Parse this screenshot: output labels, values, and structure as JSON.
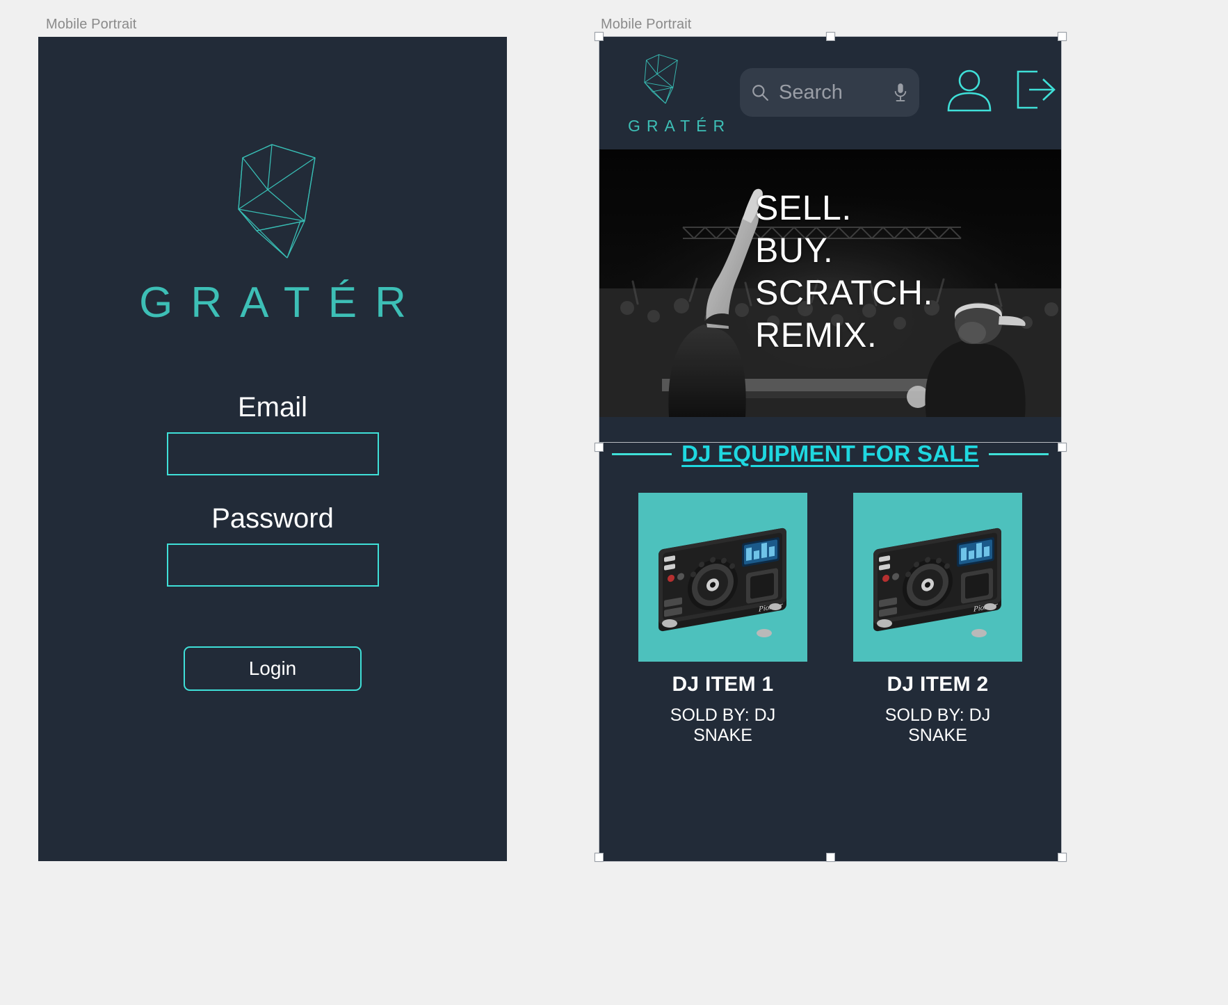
{
  "boards": {
    "left_label": "Mobile Portrait",
    "right_label": "Mobile Portrait"
  },
  "colors": {
    "canvas": "#f0f0f0",
    "screen_bg": "#222b38",
    "accent_cyan": "#3fe0d8",
    "brand_teal": "#3dbfb6",
    "product_tile": "#4dc1bd",
    "heading_cyan": "#1fd8e0",
    "search_pill": "#333c49",
    "muted_text": "#9a9ea6"
  },
  "login_screen": {
    "logo_icon": "crystal-wireframe-icon",
    "brand": "GRATÉR",
    "email": {
      "label": "Email",
      "value": "",
      "placeholder": ""
    },
    "password": {
      "label": "Password",
      "value": "",
      "placeholder": ""
    },
    "login_button": "Login"
  },
  "store_screen": {
    "header": {
      "logo_icon": "crystal-wireframe-icon",
      "brand": "GRATÉR",
      "search": {
        "placeholder": "Search",
        "value": "",
        "left_icon": "search-icon",
        "right_icon": "microphone-icon"
      },
      "account_icon": "user-account-icon",
      "logout_icon": "logout-arrow-icon"
    },
    "hero": {
      "image_alt": "dj-crowd-photo",
      "lines": [
        "SELL.",
        "BUY.",
        "SCRATCH.",
        "REMIX."
      ]
    },
    "section": {
      "title": "DJ EQUIPMENT FOR SALE"
    },
    "products": [
      {
        "image_alt": "dj-controller-photo",
        "title": "DJ ITEM 1",
        "seller": "SOLD BY: DJ SNAKE"
      },
      {
        "image_alt": "dj-controller-photo",
        "title": "DJ ITEM 2",
        "seller": "SOLD BY: DJ SNAKE"
      }
    ]
  }
}
